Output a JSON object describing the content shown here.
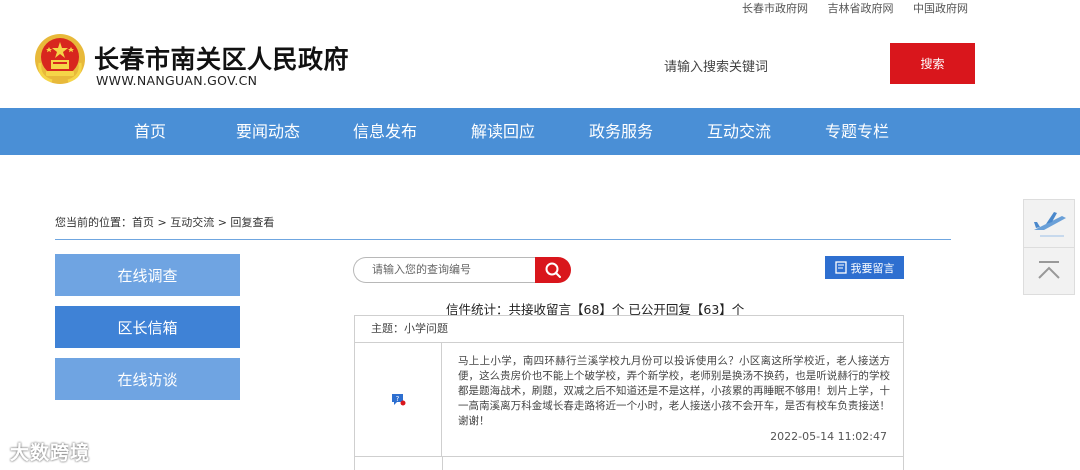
{
  "top_links": [
    "长春市政府网",
    "吉林省政府网",
    "中国政府网"
  ],
  "site": {
    "title": "长春市南关区人民政府",
    "url": "WWW.NANGUAN.GOV.CN"
  },
  "header_search": {
    "placeholder": "请输入搜索关键词",
    "button_label": "搜索"
  },
  "nav": [
    "首页",
    "要闻动态",
    "信息发布",
    "解读回应",
    "政务服务",
    "互动交流",
    "专题专栏"
  ],
  "breadcrumb": "您当前的位置：首页 > 互动交流 > 回复查看",
  "sidebar": [
    "在线调查",
    "区长信箱",
    "在线访谈"
  ],
  "query": {
    "placeholder": "请输入您的查询编号"
  },
  "leave_message_label": "我要留言",
  "stats": "信件统计：共接收留言【68】个 已公开回复【63】个",
  "letter": {
    "subject": "主题：小学问题",
    "content": "马上上小学，南四环赫行兰溪学校九月份可以投诉使用么？小区离这所学校近，老人接送方便，这么贵房价也不能上个破学校，弄个新学校，老师别是换汤不换药，也是听说赫行的学校都是题海战术，刷题，双减之后不知道还是不是这样，小孩累的再睡眠不够用！划片上学，十一高南溪离万科金域长春走路将近一个小时，老人接送小孩不会开车，是否有校车负责接送！谢谢！",
    "date": "2022-05-14 11:02:47"
  },
  "watermark": "大数跨境",
  "colors": {
    "nav_blue": "#4a8fd6",
    "accent_red": "#d9161c",
    "sidebar_active": "#3f82d6",
    "sidebar_inactive": "#6fa4e2"
  }
}
